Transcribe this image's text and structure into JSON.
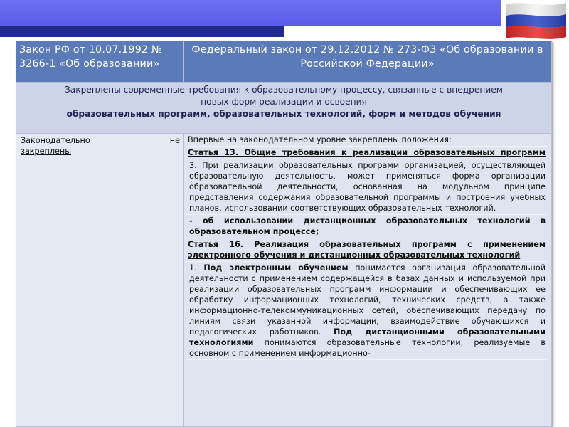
{
  "header": {
    "left_title": "Закон РФ от 10.07.1992 № 3266-1 «Об образовании»",
    "right_title": "Федеральный закон от 29.12.2012 № 273-ФЗ «Об образовании в Российской Федерации»"
  },
  "summary_row": {
    "line1": "Закреплены современные требования к образовательному процессу, связанные с внедрением",
    "line2": "новых форм реализации и освоения",
    "line3": "образовательных программ, образовательных технологий, форм и методов обучения"
  },
  "left_column": {
    "line1": "Законодательно не",
    "line2": "закреплены"
  },
  "right_column": {
    "intro": "Впервые на законодательном уровне  закреплены положения:",
    "article13_title": "Статья 13. Общие требования к реализации образовательных программ",
    "article13_p3": "3. При реализации образовательных программ организацией, осуществляющей образовательную деятельность, может применяться форма организации образовательной деятельности, основанная на модульном принципе представления содержания образовательной программы и построения учебных планов, использовании соответствующих образовательных технологий.",
    "distance_point": "- об использовании дистанционных образовательных технологий в образовательном процессе;",
    "article16_title": "Статья 16. Реализация образовательных программ с применением электронного обучения и дистанционных образовательных технологий",
    "article16_p1_num": "1.",
    "article16_p1_term": "Под электронным обучением",
    "article16_p1_text": " понимается организация образовательной деятельности с применением содержащейся в базах данных и используемой при реализации образовательных программ информации и обеспечивающих ее обработку информационных технологий, технических средств, а также информационно-телекоммуникационных сетей, обеспечивающих передачу по линиям связи указанной информации, взаимодействие обучающихся и педагогических работников. ",
    "article16_p1_term2": "Под дистанционными образовательными технологиями",
    "article16_p1_text2": " понимаются образовательные технологии, реализуемые в основном с применением информационно-"
  }
}
